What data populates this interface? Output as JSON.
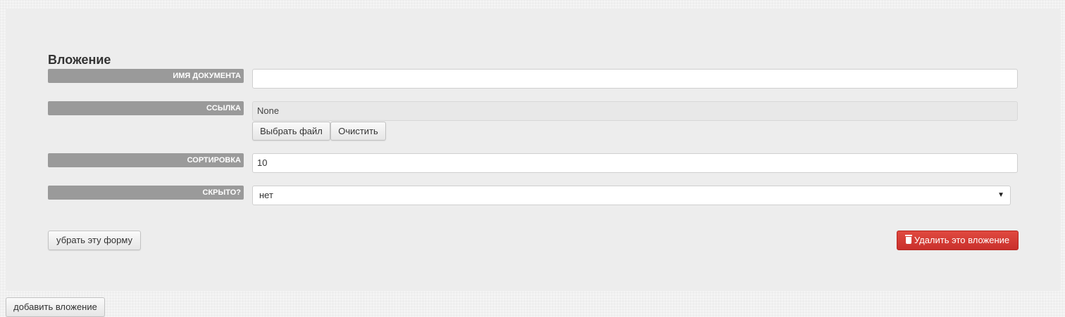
{
  "form": {
    "title": "Вложение",
    "fields": {
      "doc_name": {
        "label": "ИМЯ ДОКУМЕНТА",
        "value": ""
      },
      "link": {
        "label": "ССЫЛКА",
        "value": "None",
        "choose_label": "Выбрать файл",
        "clear_label": "Очистить"
      },
      "sort": {
        "label": "СОРТИРОВКА",
        "value": "10"
      },
      "hidden": {
        "label": "СКРЫТО?",
        "value": "нет"
      }
    },
    "remove_form_label": "убрать эту форму",
    "delete_label": "Удалить это вложение"
  },
  "footer": {
    "add_label": "добавить вложение"
  },
  "colors": {
    "danger": "#d9534f",
    "label_bg": "#9a9a9a",
    "panel_bg": "#ededed"
  },
  "icons": {
    "delete": "trash-icon",
    "select": "caret-down-icon"
  }
}
